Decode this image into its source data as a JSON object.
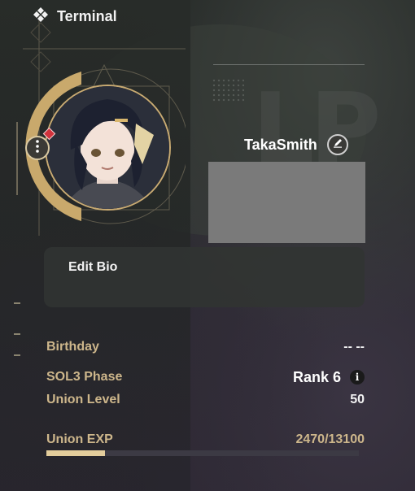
{
  "header": {
    "title": "Terminal",
    "icon": "diamond-cluster-icon"
  },
  "profile": {
    "username": "TakaSmith",
    "edit_bio_label": "Edit Bio",
    "avatar": "character-portrait"
  },
  "stats": {
    "birthday": {
      "label": "Birthday",
      "value": "-- --"
    },
    "sol3_phase": {
      "label": "SOL3 Phase",
      "value": "Rank 6"
    },
    "union_level": {
      "label": "Union Level",
      "value": "50"
    },
    "union_exp": {
      "label": "Union EXP",
      "value": "2470/13100",
      "current": 2470,
      "max": 13100
    }
  },
  "colors": {
    "accent_gold": "#cdb68b",
    "exp_fill": "#e3cd9c",
    "notification": "#d2323c"
  }
}
